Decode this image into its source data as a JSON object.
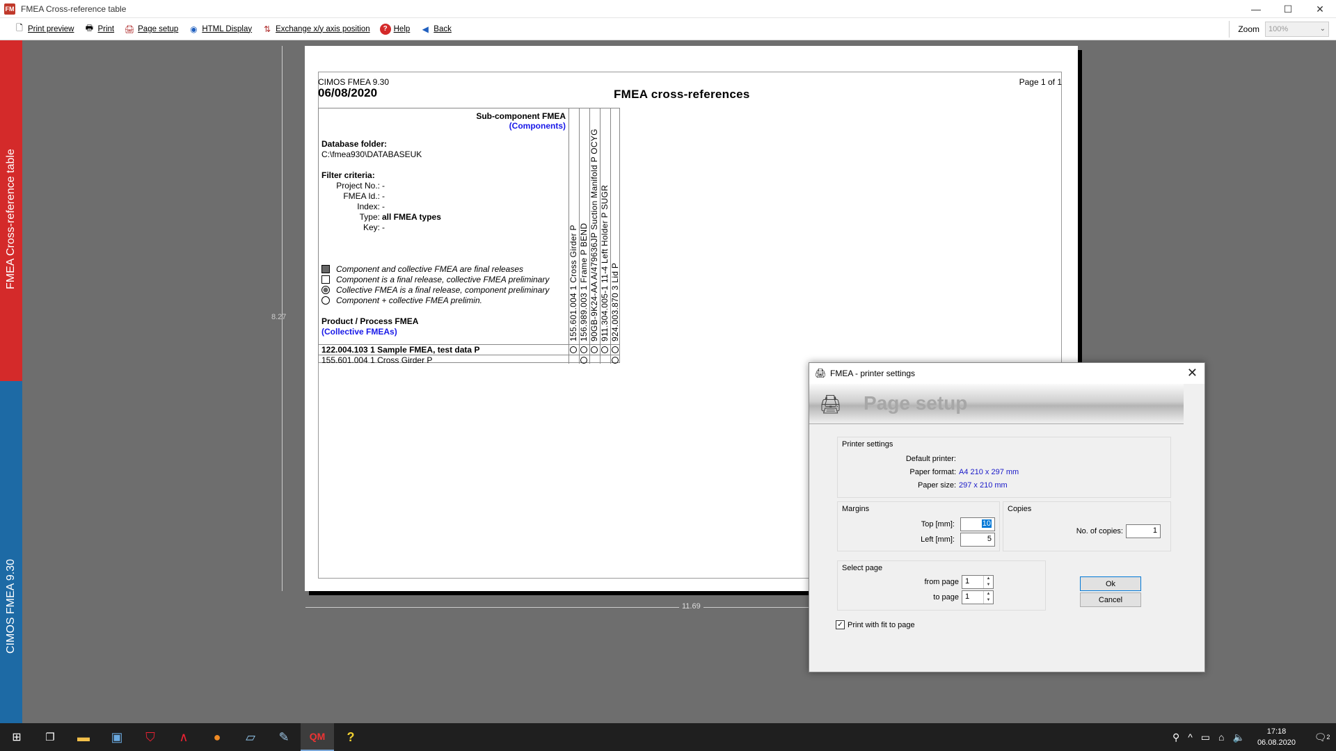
{
  "window": {
    "title": "FMEA Cross-reference table",
    "minimize": "—",
    "maximize": "☐",
    "close": "✕"
  },
  "toolbar": {
    "items": [
      {
        "label": "Print preview",
        "icon": "page-icon"
      },
      {
        "label": "Print",
        "icon": "printer-icon"
      },
      {
        "label": "Page setup",
        "icon": "page-setup-icon"
      },
      {
        "label": "HTML Display",
        "icon": "globe-icon"
      },
      {
        "label": "Exchange x/y axis position",
        "icon": "exchange-axis-icon"
      },
      {
        "label": "Help",
        "icon": "help-icon"
      },
      {
        "label": "Back",
        "icon": "back-arrow-icon"
      }
    ],
    "zoom_label": "Zoom",
    "zoom_value": "100%"
  },
  "side_banner": {
    "top_text": "FMEA Cross-reference table",
    "bottom_text": "CIMOS FMEA 9.30",
    "top_color": "#d42a2a",
    "bottom_color": "#1d6aa5"
  },
  "preview": {
    "height_label": "8.27",
    "width_label": "11.69"
  },
  "report": {
    "app": "CIMOS FMEA 9.30",
    "date": "06/08/2020",
    "title": "FMEA  cross-references",
    "page": "Page 1 of 1",
    "sub_component_title": "Sub-component FMEA",
    "sub_component_sub": "(Components)",
    "db_folder_label": "Database folder:",
    "db_folder_value": "C:\\fmea930\\DATABASEUK",
    "filter_title": "Filter criteria:",
    "filters": [
      {
        "k": "Project No.:",
        "v": "-"
      },
      {
        "k": "FMEA Id.:",
        "v": "-"
      },
      {
        "k": "Index:",
        "v": "-"
      },
      {
        "k": "Type:",
        "v": "all FMEA types"
      },
      {
        "k": "Key:",
        "v": "-"
      }
    ],
    "legend": [
      "Component and collective FMEA are final releases",
      "Component is a final release, collective FMEA preliminary",
      "Collective FMEA is a final release, component preliminary",
      "Component + collective FMEA prelimin."
    ],
    "product_title": "Product / Process FMEA",
    "product_sub": "(Collective FMEAs)",
    "columns": [
      "155.601.004  1  Cross Girder  P",
      "156.989.003  1  Frame  P  BEND",
      "90GB-9K24-AA  A/479636JP  Suction Manifold  P  OCYG",
      "911.304.005-1  11-4  Left Holder  P  SUGR",
      "924.003.870  3  Lid  P"
    ],
    "rows": [
      {
        "label": "122.004.103  1  Sample FMEA, test data  P",
        "cells": [
          1,
          1,
          1,
          1,
          1
        ]
      },
      {
        "label": "155.601.004  1  Cross Girder  P",
        "cells": [
          0,
          1,
          0,
          0,
          1
        ]
      }
    ]
  },
  "dialog": {
    "title": "FMEA - printer settings",
    "banner": "Page setup",
    "printer_group": "Printer settings",
    "default_printer_label": "Default printer:",
    "default_printer_value": "",
    "paper_format_label": "Paper format:",
    "paper_format_value": "A4 210 x 297 mm",
    "paper_size_label": "Paper size:",
    "paper_size_value": "297 x 210 mm",
    "margins_group": "Margins",
    "top_label": "Top [mm]:",
    "top_value": "10",
    "left_label": "Left [mm]:",
    "left_value": "5",
    "copies_group": "Copies",
    "copies_label": "No. of copies:",
    "copies_value": "1",
    "select_group": "Select page",
    "from_label": "from page",
    "from_value": "1",
    "to_label": "to page",
    "to_value": "1",
    "ok": "Ok",
    "cancel": "Cancel",
    "fit_label": "Print with fit to page"
  },
  "taskbar": {
    "time": "17:18",
    "date": "06.08.2020",
    "notifications": "2"
  }
}
